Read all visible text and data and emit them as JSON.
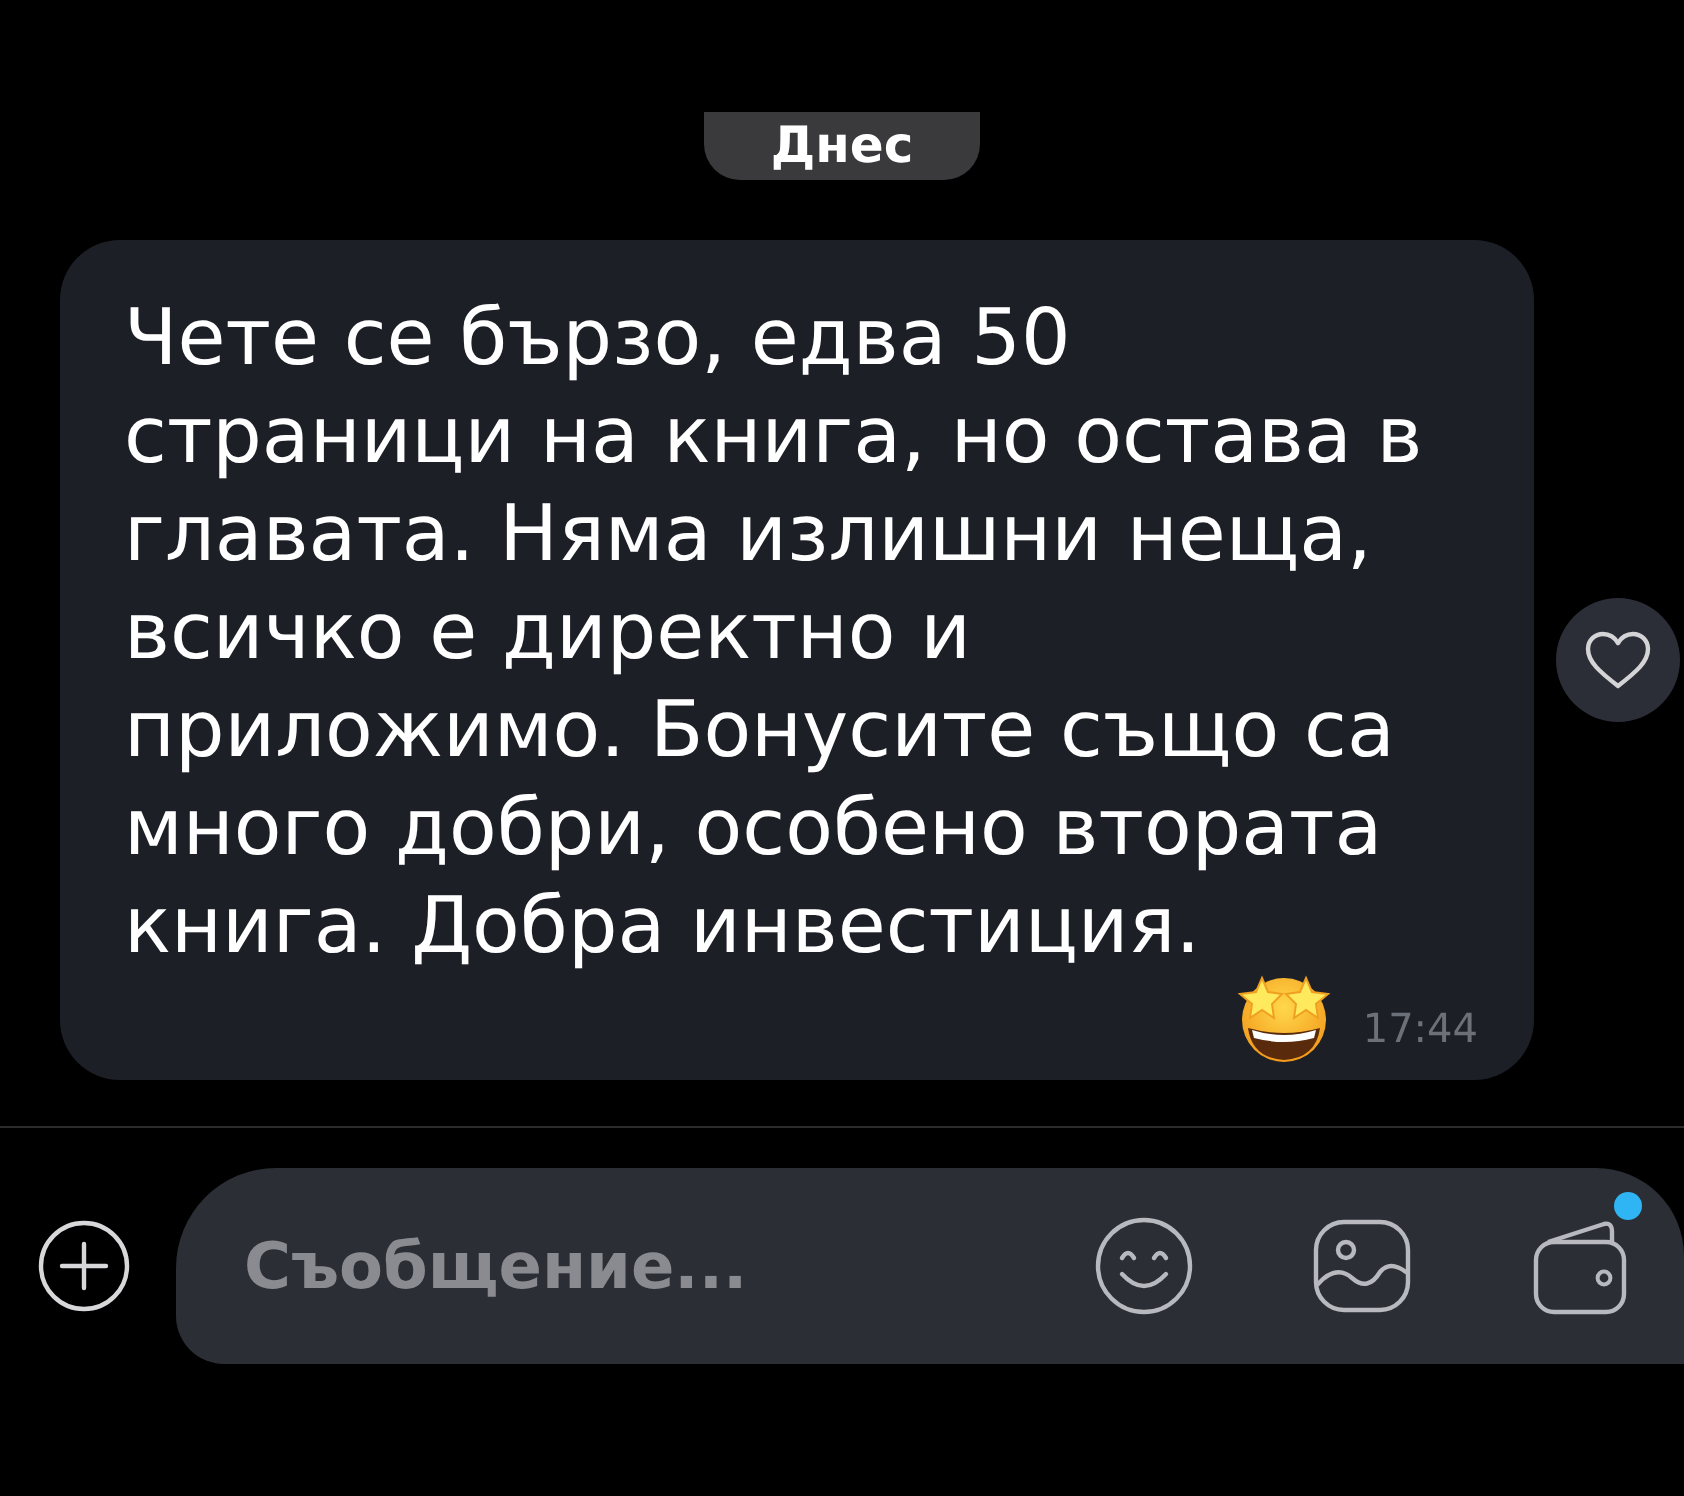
{
  "date_separator": {
    "label": "Днес"
  },
  "message": {
    "text": "Чете се бързо, едва 50 страници на книга, но остава в главата. Няма излишни неща, всичко е директно и приложимо. Бонусите също са много добри, особено втората книга. Добра инвестиция.",
    "time": "17:44"
  },
  "composer": {
    "placeholder": "Съобщение...",
    "sticker_badge": true
  }
}
